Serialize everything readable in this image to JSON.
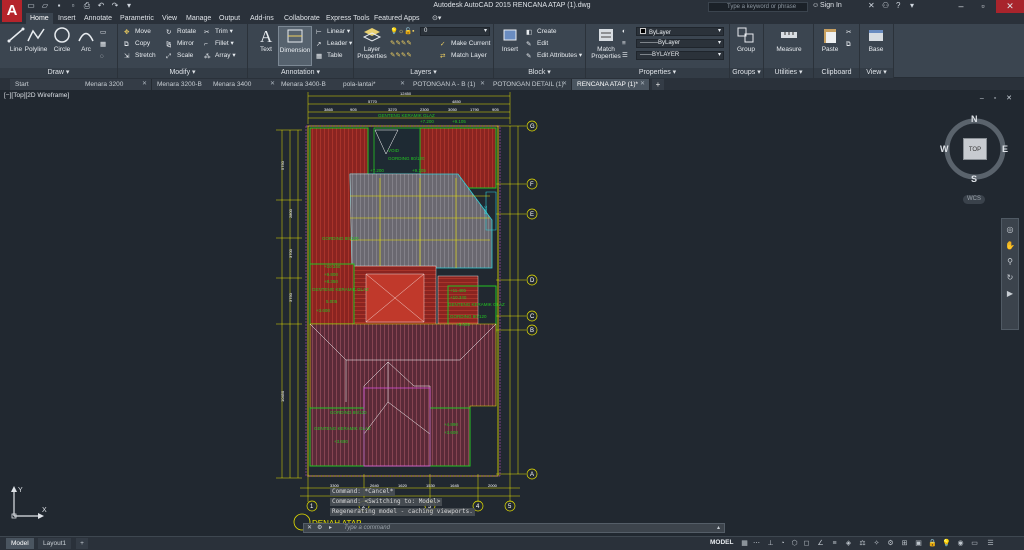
{
  "app": {
    "logo": "A",
    "title": "Autodesk AutoCAD 2015   RENCANA ATAP (1).dwg",
    "search_placeholder": "Type a keyword or phrase",
    "sign_in": "Sign In"
  },
  "ribbon_tabs": [
    "Home",
    "Insert",
    "Annotate",
    "Parametric",
    "View",
    "Manage",
    "Output",
    "Add-ins",
    "Collaborate",
    "Express Tools",
    "Featured Apps"
  ],
  "panels": {
    "draw": {
      "title": "Draw",
      "line": "Line",
      "polyline": "Polyline",
      "circle": "Circle",
      "arc": "Arc"
    },
    "modify": {
      "title": "Modify",
      "move": "Move",
      "rotate": "Rotate",
      "trim": "Trim",
      "copy": "Copy",
      "mirror": "Mirror",
      "fillet": "Fillet",
      "stretch": "Stretch",
      "scale": "Scale",
      "array": "Array"
    },
    "annotation": {
      "title": "Annotation",
      "text": "Text",
      "dimension": "Dimension",
      "linear": "Linear",
      "leader": "Leader",
      "table": "Table"
    },
    "layers": {
      "title": "Layers",
      "layer_properties": "Layer Properties",
      "current_layer": "0",
      "make_current": "Make Current",
      "match_layer": "Match Layer"
    },
    "block": {
      "title": "Block",
      "insert": "Insert",
      "create": "Create",
      "edit": "Edit",
      "edit_attributes": "Edit Attributes"
    },
    "properties": {
      "title": "Properties",
      "match": "Match Properties",
      "color": "ByLayer",
      "linetype": "ByLayer",
      "lineweight": "BYLAYER"
    },
    "groups": {
      "title": "Groups",
      "group": "Group"
    },
    "utilities": {
      "title": "Utilities",
      "measure": "Measure"
    },
    "clipboard": {
      "title": "Clipboard",
      "paste": "Paste"
    },
    "view": {
      "title": "View",
      "base": "Base"
    }
  },
  "file_tabs": [
    "Start",
    "Menara 3200",
    "Menara 3200-B",
    "Menara 3400",
    "Menara 3400-B",
    "pola-lantai*",
    "POTONGAN A - B (1)",
    "POTONGAN DETAIL (1)",
    "RENCANA ATAP (1)*"
  ],
  "viewport": {
    "label": "[−][Top][2D Wireframe]",
    "viewcube": {
      "n": "N",
      "s": "S",
      "e": "E",
      "w": "W",
      "top": "TOP",
      "wcs": "WCS"
    }
  },
  "drawing": {
    "grid_right": [
      "G",
      "F",
      "E",
      "D",
      "C",
      "B",
      "A"
    ],
    "grid_bottom": [
      "1",
      "2",
      "3",
      "4",
      "5"
    ],
    "dims_top": [
      "12450",
      "5770",
      "4850",
      "3865",
      "905",
      "3270",
      "2300",
      "3050",
      "1790",
      "905"
    ],
    "dims_bottom": [
      "3300",
      "2640",
      "1620",
      "1530",
      "1645",
      "2000"
    ],
    "dims_left": [
      "5750",
      "2800",
      "3700",
      "3750",
      "10450"
    ],
    "notes": [
      "GENTENG KERAMIK GLAZ",
      "+7.200",
      "+9.105",
      "VOID",
      "GORDING 80/120",
      "+7.200",
      "+9.105",
      "GORDING 80/120",
      "+10.340",
      "+9.800",
      "+8.350",
      "GENTENG KERAMIK GLAZ",
      "5.005",
      "+3.600",
      "+11.485",
      "+10.340",
      "GENTENG KERAMIK GLAZ",
      "GORDING 80/120",
      "+5.005",
      "GORDING 80/120",
      "GENTENG KERAMIK GLAZ",
      "+3.600",
      "+4.890",
      "+3.600",
      "RISC"
    ],
    "bottom_title": "DENAH ATAP"
  },
  "command": {
    "history": [
      "Command: *Cancel*",
      "Command:  <Switching to: Model>",
      "Regenerating model - caching viewports."
    ],
    "placeholder": "Type a command"
  },
  "status": {
    "layout_tabs": [
      "Model",
      "Layout1"
    ],
    "space": "MODEL"
  },
  "colors": {
    "background": "#212830",
    "roof_red": "#c0392b",
    "green": "#22c522",
    "yellow": "#e8e200",
    "magenta": "#d44fd4",
    "cyan": "#2fd0d8"
  }
}
